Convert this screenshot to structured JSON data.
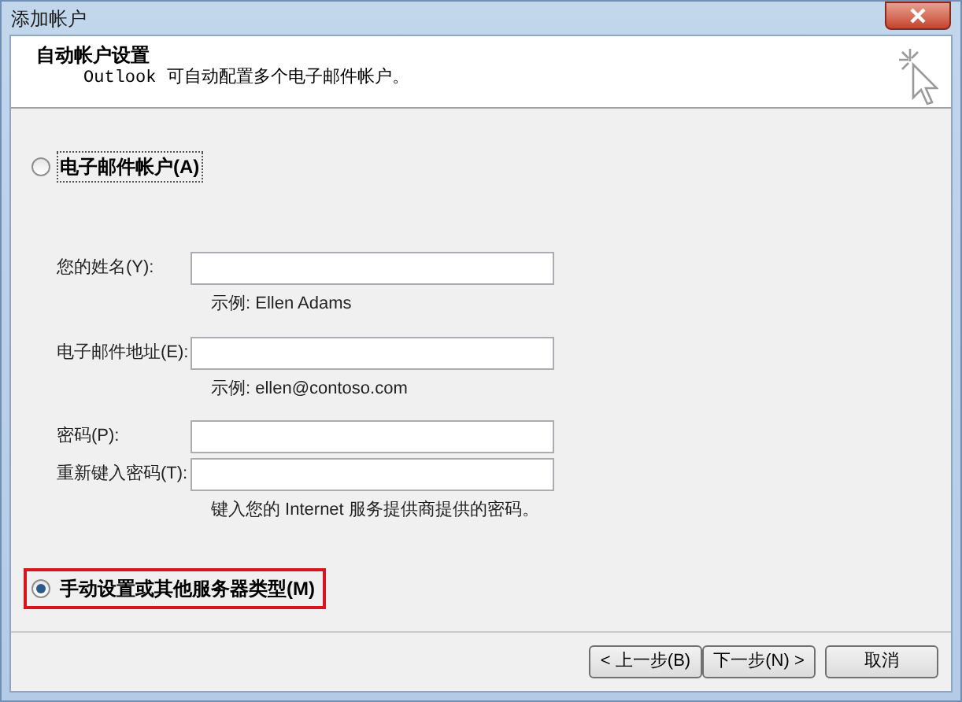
{
  "window": {
    "title": "添加帐户"
  },
  "header": {
    "title": "自动帐户设置",
    "subtitle": "Outlook 可自动配置多个电子邮件帐户。"
  },
  "options": [
    {
      "label": "电子邮件帐户(A)",
      "selected": false,
      "highlighted": false
    },
    {
      "label": "手动设置或其他服务器类型(M)",
      "selected": true,
      "highlighted": true
    }
  ],
  "fields": [
    {
      "label": "您的姓名(Y):",
      "hint": "示例: Ellen Adams"
    },
    {
      "label": "电子邮件地址(E):",
      "hint": "示例: ellen@contoso.com"
    },
    {
      "label": "密码(P):"
    },
    {
      "label": "重新键入密码(T):",
      "hint": "键入您的 Internet 服务提供商提供的密码。"
    }
  ],
  "buttons": [
    "< 上一步(B)",
    "下一步(N) >",
    "取消"
  ]
}
